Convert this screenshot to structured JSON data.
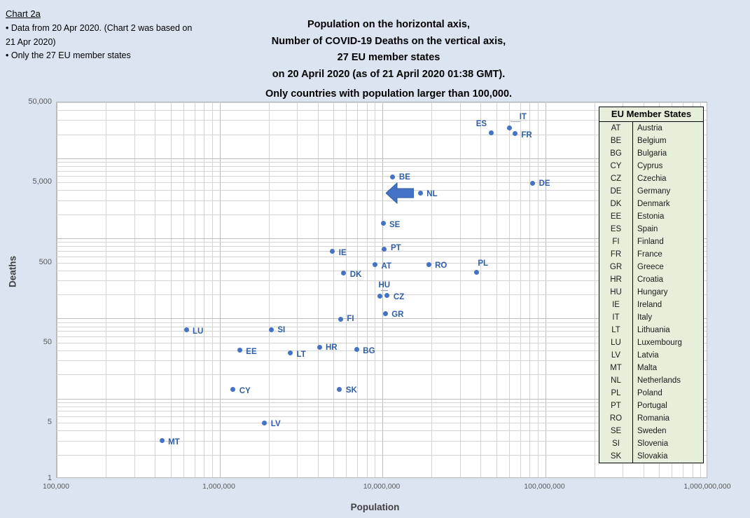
{
  "note": {
    "title": "Chart 2a",
    "lines": [
      "• Data from 20 Apr 2020.  (Chart 2 was based on",
      "21 Apr 2020)",
      "• Only the 27 EU member states"
    ]
  },
  "title_lines": [
    "Population on the horizontal axis,",
    "Number of COVID-19 Deaths on the vertical axis,",
    "27 EU member states",
    "on 20 April 2020 (as of 21 April 2020 01:38 GMT).",
    "Only countries with population larger than 100,000."
  ],
  "legend": {
    "header": "EU Member States",
    "rows": [
      {
        "code": "AT",
        "name": "Austria"
      },
      {
        "code": "BE",
        "name": "Belgium"
      },
      {
        "code": "BG",
        "name": "Bulgaria"
      },
      {
        "code": "CY",
        "name": "Cyprus"
      },
      {
        "code": "CZ",
        "name": "Czechia"
      },
      {
        "code": "DE",
        "name": "Germany"
      },
      {
        "code": "DK",
        "name": "Denmark"
      },
      {
        "code": "EE",
        "name": "Estonia"
      },
      {
        "code": "ES",
        "name": "Spain"
      },
      {
        "code": "FI",
        "name": "Finland"
      },
      {
        "code": "FR",
        "name": "France"
      },
      {
        "code": "GR",
        "name": "Greece"
      },
      {
        "code": "HR",
        "name": "Croatia"
      },
      {
        "code": "HU",
        "name": "Hungary"
      },
      {
        "code": "IE",
        "name": "Ireland"
      },
      {
        "code": "IT",
        "name": "Italy"
      },
      {
        "code": "LT",
        "name": "Lithuania"
      },
      {
        "code": "LU",
        "name": "Luxembourg"
      },
      {
        "code": "LV",
        "name": "Latvia"
      },
      {
        "code": "MT",
        "name": "Malta"
      },
      {
        "code": "NL",
        "name": "Netherlands"
      },
      {
        "code": "PL",
        "name": "Poland"
      },
      {
        "code": "PT",
        "name": "Portugal"
      },
      {
        "code": "RO",
        "name": "Romania"
      },
      {
        "code": "SE",
        "name": "Sweden"
      },
      {
        "code": "SI",
        "name": "Slovenia"
      },
      {
        "code": "SK",
        "name": "Slovakia"
      }
    ]
  },
  "annotation": {
    "arrow": "left-arrow-pointing-at-NL",
    "color": "#4472c4"
  },
  "colors": {
    "background": "#dce3f1",
    "marker": "#4472c4",
    "label": "#2e5fa3",
    "legend_fill": "#e6efda",
    "gridline": "#d4d4d4"
  },
  "chart_data": {
    "type": "scatter",
    "title": "Population on the horizontal axis, Number of COVID-19 Deaths on the vertical axis, 27 EU member states on 20 April 2020 (as of 21 April 2020 01:38 GMT). Only countries with population larger than 100,000.",
    "xlabel": "Population",
    "ylabel": "Deaths",
    "xscale": "log",
    "yscale": "log",
    "xlim": [
      100000,
      1000000000
    ],
    "ylim": [
      1,
      50000
    ],
    "xticks": [
      100000,
      1000000,
      10000000,
      100000000,
      1000000000
    ],
    "xticklabels": [
      "100,000",
      "1,000,000",
      "10,000,000",
      "100,000,000",
      "1,000,000,000"
    ],
    "yticks": [
      1,
      5,
      50,
      500,
      5000,
      50000
    ],
    "yticklabels": [
      "1",
      "5",
      "50",
      "500",
      "5,000",
      "50,000"
    ],
    "grid": true,
    "legend_position": "right",
    "points": [
      {
        "code": "ES",
        "name": "Spain",
        "x": 46750000,
        "y": 20850,
        "label_dx": -22,
        "label_dy": -12
      },
      {
        "code": "IT",
        "name": "Italy",
        "x": 60460000,
        "y": 24100,
        "label_dx": 14,
        "label_dy": -15,
        "leader": true
      },
      {
        "code": "FR",
        "name": "France",
        "x": 65270000,
        "y": 20270,
        "label_dx": 9,
        "label_dy": 2
      },
      {
        "code": "DE",
        "name": "Germany",
        "x": 83780000,
        "y": 4862,
        "label_dx": 9,
        "label_dy": 0
      },
      {
        "code": "BE",
        "name": "Belgium",
        "x": 11590000,
        "y": 5828,
        "label_dx": 9,
        "label_dy": 0
      },
      {
        "code": "NL",
        "name": "Netherlands",
        "x": 17130000,
        "y": 3697,
        "label_dx": 9,
        "label_dy": 2
      },
      {
        "code": "SE",
        "name": "Sweden",
        "x": 10100000,
        "y": 1540,
        "label_dx": 9,
        "label_dy": 2
      },
      {
        "code": "PT",
        "name": "Portugal",
        "x": 10200000,
        "y": 735,
        "label_dx": 10,
        "label_dy": -1
      },
      {
        "code": "IE",
        "name": "Ireland",
        "x": 4940000,
        "y": 687,
        "label_dx": 9,
        "label_dy": 2
      },
      {
        "code": "AT",
        "name": "Austria",
        "x": 9010000,
        "y": 470,
        "label_dx": 9,
        "label_dy": 2
      },
      {
        "code": "RO",
        "name": "Romania",
        "x": 19240000,
        "y": 470,
        "label_dx": 9,
        "label_dy": 1
      },
      {
        "code": "PL",
        "name": "Poland",
        "x": 37850000,
        "y": 380,
        "label_dx": 2,
        "label_dy": -12
      },
      {
        "code": "DK",
        "name": "Denmark",
        "x": 5790000,
        "y": 370,
        "label_dx": 9,
        "label_dy": 2
      },
      {
        "code": "HU",
        "name": "Hungary",
        "x": 9660000,
        "y": 189,
        "label_dx": -2,
        "label_dy": -16,
        "leader": true
      },
      {
        "code": "CZ",
        "name": "Czechia",
        "x": 10710000,
        "y": 194,
        "label_dx": 9,
        "label_dy": 2
      },
      {
        "code": "GR",
        "name": "Greece",
        "x": 10420000,
        "y": 116,
        "label_dx": 9,
        "label_dy": 2
      },
      {
        "code": "FI",
        "name": "Finland",
        "x": 5540000,
        "y": 98,
        "label_dx": 9,
        "label_dy": 0
      },
      {
        "code": "LU",
        "name": "Luxembourg",
        "x": 625000,
        "y": 72,
        "label_dx": 9,
        "label_dy": 2
      },
      {
        "code": "SI",
        "name": "Slovenia",
        "x": 2080000,
        "y": 72,
        "label_dx": 9,
        "label_dy": 0
      },
      {
        "code": "HR",
        "name": "Croatia",
        "x": 4100000,
        "y": 44,
        "label_dx": 9,
        "label_dy": 1
      },
      {
        "code": "BG",
        "name": "Bulgaria",
        "x": 6950000,
        "y": 41,
        "label_dx": 9,
        "label_dy": 2
      },
      {
        "code": "EE",
        "name": "Estonia",
        "x": 1330000,
        "y": 40,
        "label_dx": 9,
        "label_dy": 2
      },
      {
        "code": "LT",
        "name": "Lithuania",
        "x": 2720000,
        "y": 37,
        "label_dx": 9,
        "label_dy": 2
      },
      {
        "code": "CY",
        "name": "Cyprus",
        "x": 1210000,
        "y": 13,
        "label_dx": 9,
        "label_dy": 2
      },
      {
        "code": "SK",
        "name": "Slovakia",
        "x": 5460000,
        "y": 13,
        "label_dx": 9,
        "label_dy": 1
      },
      {
        "code": "LV",
        "name": "Latvia",
        "x": 1890000,
        "y": 5,
        "label_dx": 9,
        "label_dy": 2
      },
      {
        "code": "MT",
        "name": "Malta",
        "x": 442000,
        "y": 3,
        "label_dx": 9,
        "label_dy": 2
      }
    ]
  }
}
